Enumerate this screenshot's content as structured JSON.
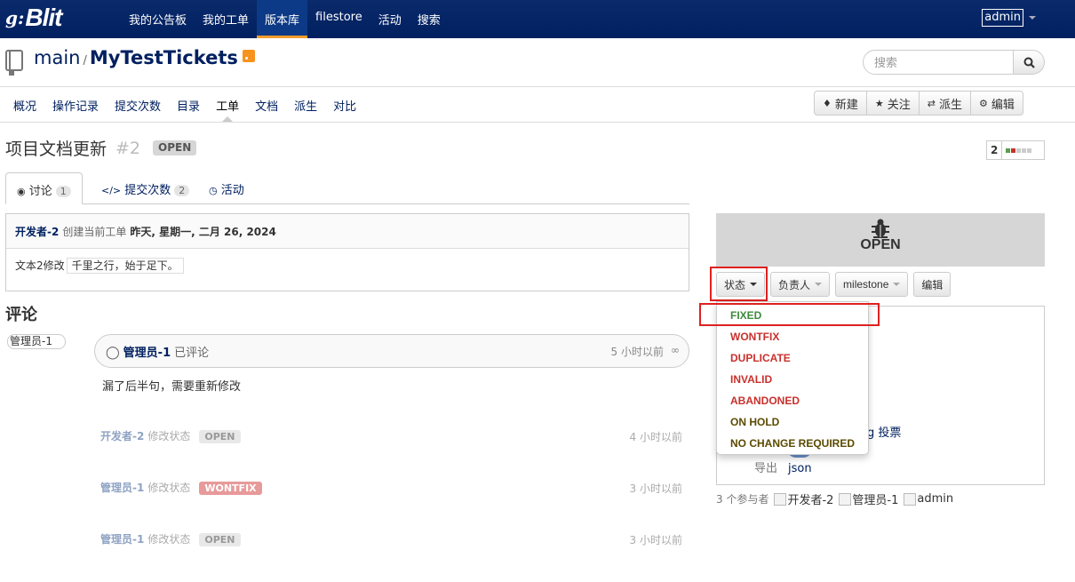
{
  "colors": {
    "navbar": "#002060",
    "accent": "#f39c2b",
    "fixed": "#3c8a3c",
    "red": "#c9302c",
    "hold": "#5a4a00"
  },
  "navbar": {
    "logo_g": "g:",
    "logo_text": "Blit",
    "items": [
      "我的公告板",
      "我的工单",
      "版本库",
      "filestore",
      "活动",
      "搜索"
    ],
    "user": "admin"
  },
  "repo": {
    "project": "main",
    "separator": "/",
    "name": "MyTestTickets",
    "search_placeholder": "搜索"
  },
  "subnav": {
    "items": [
      "概况",
      "操作记录",
      "提交次数",
      "目录",
      "工单",
      "文档",
      "派生",
      "对比"
    ],
    "actions": {
      "new": "新建",
      "watch": "关注",
      "fork": "派生",
      "edit": "编辑"
    }
  },
  "ticket": {
    "title": "项目文档更新",
    "number": "#2",
    "status": "OPEN",
    "votes": "2"
  },
  "tabs": {
    "discussion": "讨论",
    "discussion_count": "1",
    "commits": "提交次数",
    "commits_count": "2",
    "activity": "活动"
  },
  "description": {
    "author": "开发者-2",
    "action": "创建当前工单",
    "when": "昨天, 星期一, 二月 26, 2024",
    "text": "文本2修改",
    "code": "千里之行，始于足下。"
  },
  "comments": {
    "title": "评论",
    "avatar_alt": "管理员-1",
    "author": "管理员-1",
    "action": "已评论",
    "time": "5 小时以前",
    "text": "漏了后半句，需要重新修改"
  },
  "events": [
    {
      "who": "开发者-2",
      "action": "修改状态",
      "status": "OPEN",
      "time": "4 小时以前"
    },
    {
      "who": "管理员-1",
      "action": "修改状态",
      "status": "WONTFIX",
      "time": "3 小时以前"
    },
    {
      "who": "管理员-1",
      "action": "修改状态",
      "status": "OPEN",
      "time": "3 小时以前"
    }
  ],
  "status_panel": {
    "status": "OPEN",
    "buttons": {
      "status": "状态",
      "responsible": "负责人",
      "milestone": "milestone",
      "edit": "编辑"
    }
  },
  "status_menu": [
    {
      "label": "FIXED",
      "color": "#3c8a3c"
    },
    {
      "label": "WONTFIX",
      "color": "#c9302c"
    },
    {
      "label": "DUPLICATE",
      "color": "#c9302c"
    },
    {
      "label": "INVALID",
      "color": "#c9302c"
    },
    {
      "label": "ABANDONED",
      "color": "#c9302c"
    },
    {
      "label": "ON HOLD",
      "color": "#5a4a00"
    },
    {
      "label": "NO CHANGE REQUIRED",
      "color": "#5a4a00"
    }
  ],
  "info": {
    "vote_partial": "g",
    "vote_label": "投票",
    "export_label": "导出",
    "export_link": "json"
  },
  "participants": {
    "label": "3 个参与者",
    "list": [
      "开发者-2",
      "管理员-1",
      "admin"
    ]
  }
}
